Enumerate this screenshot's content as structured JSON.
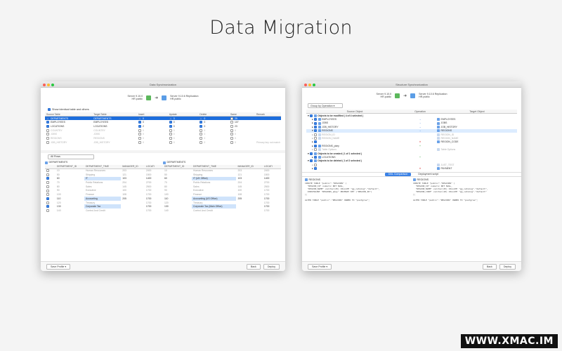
{
  "headline": "Data Migration",
  "win1": {
    "title": "Data Synchronization",
    "source_server": {
      "name": "Server 9.10.0",
      "schema": "HR.public"
    },
    "target_server": {
      "name": "Server 9.10.6 Replication",
      "schema": "HR.public"
    },
    "option_label": "Show identical table and others",
    "columns": [
      "Source Table",
      "Target Table",
      "Insert",
      "Update",
      "Delete",
      "Same",
      "Remark"
    ],
    "rows": [
      {
        "checked": true,
        "src": "DEPARTMENTS",
        "tgt": "DEPARTMENTS",
        "ins": "0",
        "upd": "3",
        "del": "0",
        "same": "29",
        "remark": "",
        "state": "sel"
      },
      {
        "checked": true,
        "src": "EMPLOYEES",
        "tgt": "EMPLOYEES",
        "ins": "0",
        "upd": "0",
        "del": "0",
        "same": "107",
        "remark": "",
        "state": ""
      },
      {
        "checked": true,
        "src": "LOCATIONS",
        "tgt": "LOCATIONS",
        "ins": "2",
        "upd": "0",
        "del": "0",
        "same": "23",
        "remark": "",
        "state": ""
      },
      {
        "checked": false,
        "src": "COUNTRY",
        "tgt": "COUNTRY",
        "ins": "0",
        "upd": "0",
        "del": "0",
        "same": "0",
        "remark": "",
        "state": "dim"
      },
      {
        "checked": false,
        "src": "JOBS",
        "tgt": "JOBS",
        "ins": "0",
        "upd": "0",
        "del": "0",
        "same": "0",
        "remark": "",
        "state": "dim"
      },
      {
        "checked": false,
        "src": "REGIONS",
        "tgt": "REGIONS",
        "ins": "0",
        "upd": "0",
        "del": "0",
        "same": "0",
        "remark": "",
        "state": "dim"
      },
      {
        "checked": false,
        "src": "JOB_HISTORY",
        "tgt": "JOB_HISTORY",
        "ins": "0",
        "upd": "0",
        "del": "0",
        "same": "0",
        "remark": "Primary key not match",
        "state": "dim"
      }
    ],
    "filter": "All Rows",
    "left_label": "DEPARTMENTS",
    "right_label": "DEPARTMENTS",
    "data_columns": [
      "DEPARTMENT_ID",
      "DEPARTMENT_TIME",
      "MANAGER_ID",
      "LOCATI",
      "DEPARTMENT_ID",
      "DEPARTMENT_TIME",
      "MANAGER_ID",
      "LOCATI"
    ],
    "data_rows": [
      {
        "chk": false,
        "c": [
          "10",
          "Human Resources",
          "203",
          "2400",
          "10",
          "Human Resources",
          "203",
          "2400"
        ],
        "hl": false,
        "dim": true
      },
      {
        "chk": false,
        "c": [
          "50",
          "Shipping",
          "121",
          "1500",
          "50",
          "Shipping",
          "121",
          "1500"
        ],
        "hl": false,
        "dim": true
      },
      {
        "chk": true,
        "c": [
          "60",
          "IT",
          "103",
          "1400",
          "60",
          "IT (UK Office)",
          "103",
          "1400"
        ],
        "hl": true,
        "dim": false
      },
      {
        "chk": false,
        "c": [
          "70",
          "Public Relations",
          "204",
          "2700",
          "70",
          "Public Relations",
          "204",
          "2700"
        ],
        "hl": false,
        "dim": true
      },
      {
        "chk": false,
        "c": [
          "80",
          "Sales",
          "145",
          "2500",
          "80",
          "Sales",
          "145",
          "2500"
        ],
        "hl": false,
        "dim": true
      },
      {
        "chk": false,
        "c": [
          "90",
          "Executive",
          "100",
          "1700",
          "90",
          "Executive",
          "100",
          "1700"
        ],
        "hl": false,
        "dim": true
      },
      {
        "chk": false,
        "c": [
          "100",
          "Finance",
          "108",
          "1700",
          "100",
          "Finance",
          "108",
          "1700"
        ],
        "hl": false,
        "dim": true
      },
      {
        "chk": true,
        "c": [
          "110",
          "Accounting",
          "205",
          "1700",
          "110",
          "Accounting (US Office)",
          "205",
          "1700"
        ],
        "hl": true,
        "dim": false
      },
      {
        "chk": false,
        "c": [
          "120",
          "Treasury",
          "",
          "1700",
          "120",
          "Treasury",
          "",
          "1700"
        ],
        "hl": false,
        "dim": true
      },
      {
        "chk": true,
        "c": [
          "130",
          "Corporate Tax",
          "",
          "1700",
          "130",
          "Corporate Tax (Main Office)",
          "",
          "1700"
        ],
        "hl": true,
        "dim": false
      },
      {
        "chk": false,
        "c": [
          "140",
          "Control And Credit",
          "",
          "1700",
          "140",
          "Control And Credit",
          "",
          "1700"
        ],
        "hl": false,
        "dim": true
      }
    ],
    "save_profile": "Save Profile",
    "back": "Back",
    "deploy": "Deploy"
  },
  "win2": {
    "title": "Structure Synchronization",
    "group_by": "Group by Operation",
    "source_server": {
      "name": "Server 9.10.0",
      "schema": "HR.public"
    },
    "target_server": {
      "name": "Server 9.10.6 Replication",
      "schema": "HR.public"
    },
    "columns": [
      "Source Object",
      "Operation",
      "Target Object"
    ],
    "tree": [
      {
        "kind": "group",
        "src": "Objects to be modified ( 4 of 4 selected )",
        "op": "",
        "tgt": ""
      },
      {
        "kind": "item",
        "src": "EMPLOYEES",
        "op": "→",
        "tgt": "EMPLOYEES"
      },
      {
        "kind": "item",
        "src": "JOBS",
        "op": "→",
        "tgt": "JOBS"
      },
      {
        "kind": "item",
        "src": "JOB_HISTORY",
        "op": "→",
        "tgt": "JOB_HISTORY"
      },
      {
        "kind": "sel",
        "src": "REGIONS",
        "op": "→",
        "tgt": "REGIONS"
      },
      {
        "kind": "dim",
        "src": "REGION_ID",
        "op": "",
        "tgt": "REGION_ID"
      },
      {
        "kind": "dim",
        "src": "REGION_NAME",
        "op": "",
        "tgt": "REGION_NAME"
      },
      {
        "kind": "item",
        "src": "",
        "op": "✕",
        "tgt": "REGION_CODE"
      },
      {
        "kind": "item",
        "src": "REGIONS_pkey",
        "op": "+",
        "tgt": ""
      },
      {
        "kind": "dim",
        "src": "Table Options",
        "op": "",
        "tgt": "Table Options"
      },
      {
        "kind": "group",
        "src": "Objects to be created ( 1 of 1 selected )",
        "op": "",
        "tgt": ""
      },
      {
        "kind": "item",
        "src": "LOCATIONS",
        "op": "+",
        "tgt": ""
      },
      {
        "kind": "group",
        "src": "Objects to be deleted ( 1 of 2 selected )",
        "op": "",
        "tgt": ""
      },
      {
        "kind": "dim",
        "src": "",
        "op": "",
        "tgt": "JUST_TEST"
      },
      {
        "kind": "item",
        "src": "",
        "op": "✕",
        "tgt": "PAYMENT"
      }
    ],
    "tab_active": "DDL Comparison",
    "tab_other": "Deployment script",
    "ddl_left_title": "REGIONS",
    "ddl_right_title": "REGIONS",
    "ddl_left": "CREATE TABLE \"public\".\"REGIONS\" (\n  \"REGION_ID\" numeric NOT NULL,\n  \"REGION_NAME\" varchar(25) COLLATE \"pg_catalog\".\"default\",\n  CONSTRAINT \"REGIONS_pkey\" PRIMARY KEY (\"REGION_ID\")\n);\n\nALTER TABLE \"public\".\"REGIONS\" OWNER TO \"postgres\";",
    "ddl_right": "CREATE TABLE \"public\".\"REGIONS\" (\n  \"REGION_ID\" numeric NOT NULL,\n  \"REGION_NAME\" varchar(25) COLLATE \"pg_catalog\".\"default\",\n  \"REGION_CODE\" varchar(10) COLLATE \"pg_catalog\".\"default\"\n);\n\nALTER TABLE \"public\".\"REGIONS\" OWNER TO \"postgres\";",
    "save_profile": "Save Profile",
    "back": "Back",
    "deploy": "Deploy"
  },
  "watermark": "WWW.XMAC.IM",
  "colors": {
    "accent": "#1c6ddc",
    "source_server": "#5cb85c",
    "target_server": "#5b9de6"
  }
}
